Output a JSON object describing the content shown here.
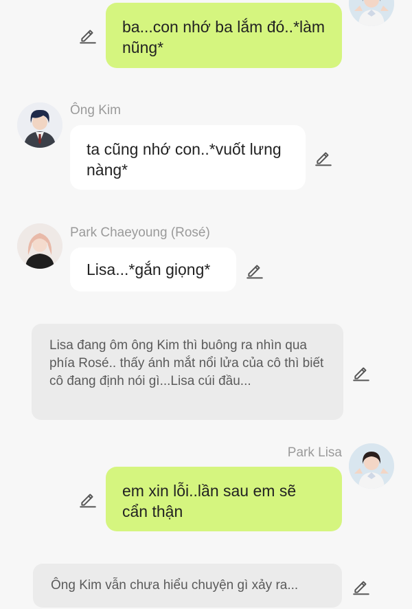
{
  "messages": [
    {
      "kind": "mine",
      "sender": "",
      "text": "ba...con nhớ ba lắm đó..*làm nũng*"
    },
    {
      "kind": "other",
      "sender": "Ông Kim",
      "text": "ta cũng nhớ con..*vuốt lưng nàng*"
    },
    {
      "kind": "other",
      "sender": "Park Chaeyoung (Rosé)",
      "text": "Lisa...*gắn giọng*"
    },
    {
      "kind": "narration",
      "sender": "",
      "text": "Lisa đang ôm ông Kim thì buông ra nhìn qua phía Rosé.. thấy ánh mắt nổi lửa của cô thì biết cô đang định nói gì...Lisa cúi đầu..."
    },
    {
      "kind": "mine",
      "sender": "Park Lisa",
      "text": "em xin lỗi..lần sau em sẽ cẩn thận"
    },
    {
      "kind": "narration",
      "sender": "",
      "text": "Ông Kim vẫn chưa hiểu chuyện gì xảy ra..."
    }
  ],
  "icons": {
    "edit": "pencil-icon",
    "avatar": "avatar-image"
  },
  "colors": {
    "background": "#f7f7f7",
    "mine_bubble": "#d5f57f",
    "other_bubble": "#ffffff",
    "narration_bubble": "#ebebeb",
    "name_text": "#9a9a9a"
  }
}
